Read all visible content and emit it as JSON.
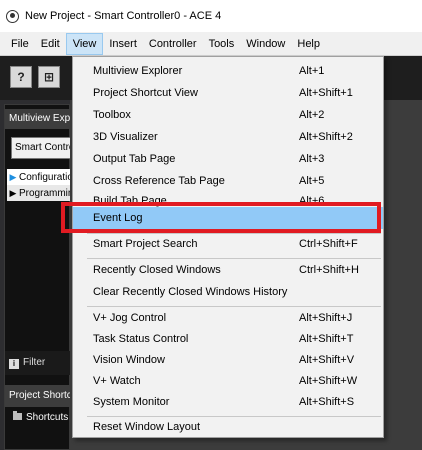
{
  "window": {
    "title": "New Project - Smart Controller0 - ACE 4"
  },
  "menubar": [
    "File",
    "Edit",
    "View",
    "Insert",
    "Controller",
    "Tools",
    "Window",
    "Help"
  ],
  "toolbar": {
    "help_button": "?",
    "second_button": "⊞"
  },
  "left_panel": {
    "header": "Multiview Explorer",
    "selector": "Smart Controller0",
    "tree": [
      "Configuration",
      "Programming"
    ],
    "filter_label": "Filter",
    "shortcut_header": "Project Shortcut View",
    "shortcut_item": "Shortcuts"
  },
  "view_menu": {
    "items": [
      {
        "label": "Multiview Explorer",
        "shortcut": "Alt+1"
      },
      {
        "label": "Project Shortcut View",
        "shortcut": "Alt+Shift+1"
      },
      {
        "label": "Toolbox",
        "shortcut": "Alt+2"
      },
      {
        "label": "3D Visualizer",
        "shortcut": "Alt+Shift+2"
      },
      {
        "label": "Output Tab Page",
        "shortcut": "Alt+3"
      },
      {
        "label": "Cross Reference Tab Page",
        "shortcut": "Alt+5"
      },
      {
        "label": "Build Tab Page",
        "shortcut": "Alt+6"
      },
      {
        "label": "Event Log",
        "shortcut": ""
      },
      {
        "label": "Smart Project Search",
        "shortcut": "Ctrl+Shift+F"
      },
      {
        "label": "Recently Closed Windows",
        "shortcut": "Ctrl+Shift+H"
      },
      {
        "label": "Clear Recently Closed Windows History",
        "shortcut": ""
      },
      {
        "label": "V+ Jog Control",
        "shortcut": "Alt+Shift+J"
      },
      {
        "label": "Task Status Control",
        "shortcut": "Alt+Shift+T"
      },
      {
        "label": "Vision Window",
        "shortcut": "Alt+Shift+V"
      },
      {
        "label": "V+ Watch",
        "shortcut": "Alt+Shift+W"
      },
      {
        "label": "System Monitor",
        "shortcut": "Alt+Shift+S"
      },
      {
        "label": "Reset Window Layout",
        "shortcut": ""
      }
    ],
    "highlighted": "Event Log"
  },
  "colors": {
    "highlight": "#91c9f7",
    "callout": "#e11b22",
    "toolbar_bg": "#1e1e1e"
  }
}
